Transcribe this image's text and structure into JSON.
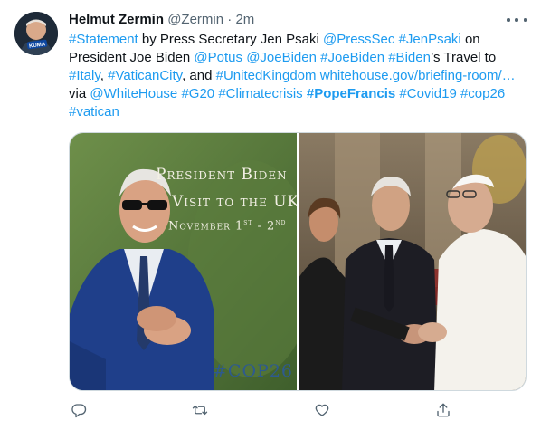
{
  "author": {
    "name": "Helmut Zermin",
    "handle": "@Zermin",
    "separator": "·",
    "time": "2m"
  },
  "tweet": {
    "segments": [
      {
        "text": "#Statement",
        "type": "link"
      },
      {
        "text": " by Press Secretary Jen Psaki ",
        "type": "plain"
      },
      {
        "text": "@PressSec",
        "type": "link"
      },
      {
        "text": " ",
        "type": "plain"
      },
      {
        "text": "#JenPsaki",
        "type": "link"
      },
      {
        "text": " on President Joe Biden ",
        "type": "plain"
      },
      {
        "text": "@Potus",
        "type": "link"
      },
      {
        "text": " ",
        "type": "plain"
      },
      {
        "text": "@JoeBiden",
        "type": "link"
      },
      {
        "text": " ",
        "type": "plain"
      },
      {
        "text": "#JoeBiden",
        "type": "link"
      },
      {
        "text": " ",
        "type": "plain"
      },
      {
        "text": "#Biden",
        "type": "link"
      },
      {
        "text": "’s Travel to ",
        "type": "plain"
      },
      {
        "text": "#Italy",
        "type": "link"
      },
      {
        "text": ", ",
        "type": "plain"
      },
      {
        "text": "#VaticanCity",
        "type": "link"
      },
      {
        "text": ", and ",
        "type": "plain"
      },
      {
        "text": "#UnitedKingdom",
        "type": "link"
      },
      {
        "text": "   ",
        "type": "plain"
      },
      {
        "text": "whitehouse.gov/briefing-room/…",
        "type": "link"
      },
      {
        "text": " via ",
        "type": "plain"
      },
      {
        "text": "@WhiteHouse",
        "type": "link"
      },
      {
        "text": " ",
        "type": "plain"
      },
      {
        "text": "#G20",
        "type": "link"
      },
      {
        "text": " ",
        "type": "plain"
      },
      {
        "text": "#Climatecrisis",
        "type": "link"
      },
      {
        "text": " ",
        "type": "plain"
      },
      {
        "text": "#PopeFrancis",
        "type": "link-bold"
      },
      {
        "text": " ",
        "type": "plain"
      },
      {
        "text": "#Covid19",
        "type": "link"
      },
      {
        "text": " ",
        "type": "plain"
      },
      {
        "text": "#cop26",
        "type": "link"
      },
      {
        "text": " ",
        "type": "plain"
      },
      {
        "text": "#vatican",
        "type": "link"
      }
    ]
  },
  "media": {
    "left_image": {
      "line1": "President Biden",
      "line2": "Visit to the UK",
      "line3_main": "November 1",
      "line3_sup1": "st",
      "line3_mid": " - 2",
      "line3_sup2": "nd",
      "hashtag": "#COP26"
    },
    "avatar_badge": "KUMA"
  },
  "colors": {
    "accent": "#1d9bf0",
    "text": "#0f1419",
    "muted": "#536471",
    "border": "#cfd9de"
  },
  "actions": {
    "icons": [
      "reply-icon",
      "retweet-icon",
      "like-icon",
      "share-icon"
    ]
  }
}
